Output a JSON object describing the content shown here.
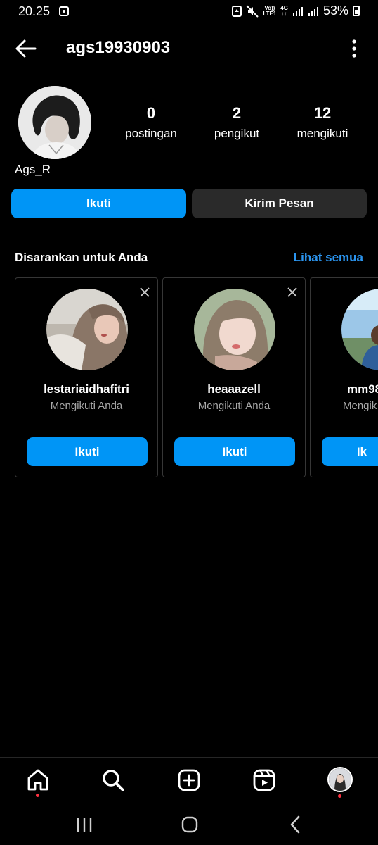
{
  "status_bar": {
    "time": "20.25",
    "network_top": "Vo))",
    "network_bottom": "LTE1",
    "network2_top": "4G",
    "network2_bottom": "↓↑",
    "battery": "53%"
  },
  "header": {
    "username": "ags19930903",
    "back_icon": "arrow-left-icon",
    "more_icon": "more-vertical-icon"
  },
  "profile": {
    "display_name": "Ags_R",
    "stats": {
      "posts": {
        "value": "0",
        "label": "postingan"
      },
      "followers": {
        "value": "2",
        "label": "pengikut"
      },
      "following": {
        "value": "12",
        "label": "mengikuti"
      }
    },
    "follow_label": "Ikuti",
    "message_label": "Kirim Pesan"
  },
  "suggestions": {
    "title": "Disarankan untuk Anda",
    "see_all": "Lihat semua",
    "cards": [
      {
        "name": "lestariaidhafitri",
        "subtitle": "Mengikuti Anda",
        "button": "Ikuti"
      },
      {
        "name": "heaaazell",
        "subtitle": "Mengikuti Anda",
        "button": "Ikuti"
      },
      {
        "name": "mm98",
        "subtitle": "Mengik",
        "button": "Ik"
      }
    ]
  },
  "bottom_nav": {
    "items": [
      "home-icon",
      "search-icon",
      "create-icon",
      "reels-icon",
      "profile-avatar"
    ]
  },
  "colors": {
    "accent": "#0095f6",
    "link": "#2b95f0",
    "notification_dot": "#ff3040"
  }
}
